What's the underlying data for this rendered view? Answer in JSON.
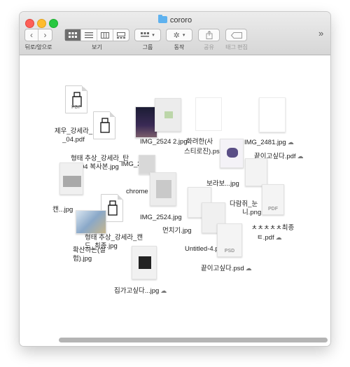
{
  "window": {
    "title": "cororo"
  },
  "toolbar": {
    "back_forward_label": "뒤로/앞으로",
    "view_label": "보기",
    "group_label": "그룹",
    "action_label": "동작",
    "share_label": "공유",
    "tags_label": "태그 편집",
    "overflow": "»"
  },
  "files": [
    {
      "label1": "제우_강세라_",
      "label2": "_04.pdf"
    },
    {
      "label1": "형태 추상_강세라_탄",
      "label2": "들_04 복사본.jpg"
    },
    {
      "label1": "IMG_2524 2.jpg",
      "label2": ""
    },
    {
      "label1": "화려한(사",
      "label2": "진).psd"
    },
    {
      "label1": "IMG_2481.jpg",
      "label2": ""
    },
    {
      "label1": "끝이고싶다.pdf",
      "label2": ""
    },
    {
      "label1": "IMG_2...jpg",
      "label2": ""
    },
    {
      "label1": "chrome",
      "label2": ""
    },
    {
      "label1": "스티로",
      "label2": ""
    },
    {
      "label1": "보라보...jpg",
      "label2": ""
    },
    {
      "label1": "다람쥐_눈",
      "label2": "니.png"
    },
    {
      "label1": "IMG_2524.jpg",
      "label2": ""
    },
    {
      "label1": "먼치기.jpg",
      "label2": ""
    },
    {
      "label1": "ㅊㅊㅊㅊㅊ최종",
      "label2": "ㅌ.pdf"
    },
    {
      "label1": "형태 추상_강세라_캔",
      "label2": "드_최종.jpg"
    },
    {
      "label1": "확산하는(실",
      "label2": "험).jpg"
    },
    {
      "label1": "Untitled-4.pdf",
      "label2": ""
    },
    {
      "label1": "끝이고싶다.psd",
      "label2": ""
    },
    {
      "label1": "집가고싶다...jpg",
      "label2": ""
    },
    {
      "label1": "캔...jpg",
      "label2": ""
    }
  ],
  "badges": {
    "pdf": "PDF",
    "psd": "PSD"
  },
  "icons": {
    "cloud": "☁"
  }
}
